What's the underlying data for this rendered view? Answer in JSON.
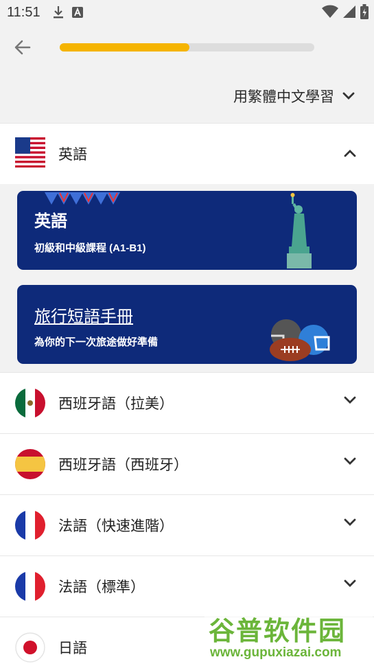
{
  "status": {
    "time": "11:51"
  },
  "progress": {
    "fraction": 0.51
  },
  "language_selector": {
    "label": "用繁體中文學習"
  },
  "expanded_language": {
    "label": "英語",
    "courses": [
      {
        "title": "英語",
        "subtitle": "初級和中級課程 (A1-B1)"
      },
      {
        "title": "旅行短語手冊",
        "subtitle": "為你的下一次旅途做好準備"
      }
    ]
  },
  "languages": [
    {
      "label": "西班牙語（拉美）",
      "flag": "mexico"
    },
    {
      "label": "西班牙語（西班牙）",
      "flag": "spain"
    },
    {
      "label": "法語（快速進階）",
      "flag": "france"
    },
    {
      "label": "法語（標準）",
      "flag": "france"
    },
    {
      "label": "日語",
      "flag": "japan"
    }
  ],
  "watermark": {
    "title": "谷普软件园",
    "url": "www.gupuxiazai.com"
  },
  "colors": {
    "accent": "#f5b400",
    "card_bg": "#0e2a7a",
    "watermark_green": "#6bb53a"
  }
}
